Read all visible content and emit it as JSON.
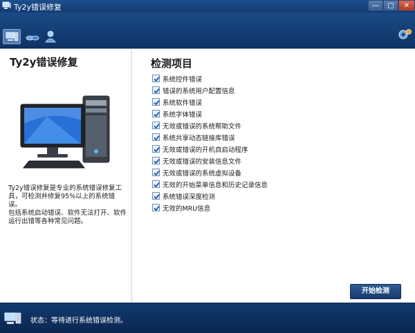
{
  "window": {
    "title": "Ty2y错误修复",
    "minimize_glyph": "—",
    "maximize_glyph": "□",
    "close_glyph": "✕"
  },
  "toolbar": {
    "icons": [
      "computer-icon",
      "connection-icon",
      "user-icon"
    ]
  },
  "left_panel": {
    "title": "Ty2y错误修复",
    "description_line1": "Ty2y错误修复是专业的系统错误修复工具，可检测并修复95%以上的系统错误。",
    "description_line2": "包括系统启动错误、软件无法打开、软件运行出错等各种常见问题。"
  },
  "check_panel": {
    "title": "检测项目",
    "items": [
      {
        "label": "系统控件错误",
        "checked": true
      },
      {
        "label": "错误的系统用户配置信息",
        "checked": true
      },
      {
        "label": "系统软件错误",
        "checked": true
      },
      {
        "label": "系统字体错误",
        "checked": true
      },
      {
        "label": "无效或错误的系统帮助文件",
        "checked": true
      },
      {
        "label": "系统共享动态链接库错误",
        "checked": true
      },
      {
        "label": "无效或错误的开机自启动程序",
        "checked": true
      },
      {
        "label": "无效或错误的安装信息文件",
        "checked": true
      },
      {
        "label": "无效或错误的系统虚拟设备",
        "checked": true
      },
      {
        "label": "无效的开始菜单信息和历史记录信息",
        "checked": true
      },
      {
        "label": "系统错误深度检测",
        "checked": true
      },
      {
        "label": "无效的MRU信息",
        "checked": true
      }
    ],
    "start_button": "开始检测"
  },
  "status": {
    "text": "状态：等待进行系统错误检测。"
  },
  "colors": {
    "frame": "#123a70",
    "panel": "#ffffff",
    "check_accent": "#1a5bb0"
  }
}
